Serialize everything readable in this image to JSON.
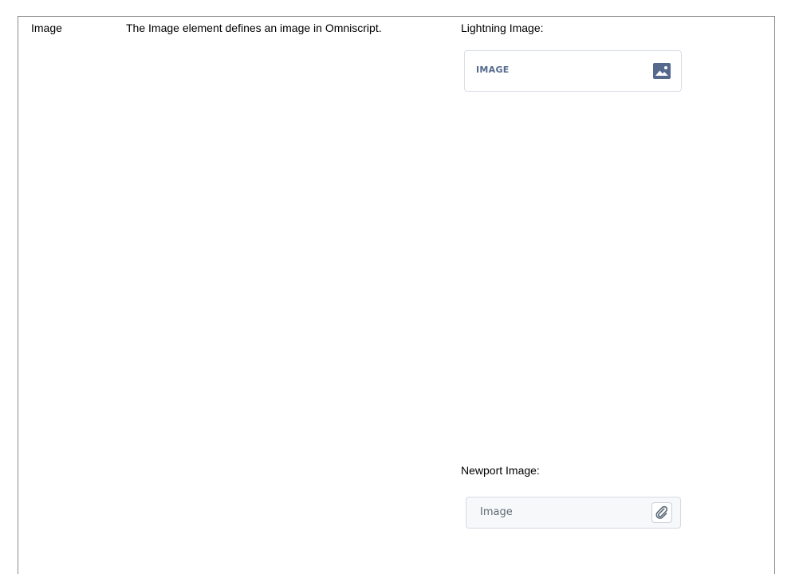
{
  "row": {
    "element_name": "Image",
    "description": "The Image element defines an image in Omniscript.",
    "lightning": {
      "label": "Lightning Image:",
      "component_text": "IMAGE",
      "icon": "image-icon",
      "accent_color": "#54698d"
    },
    "newport": {
      "label": "Newport Image:",
      "component_text": "Image",
      "icon": "paperclip-icon",
      "icon_color": "#5a6978"
    }
  }
}
